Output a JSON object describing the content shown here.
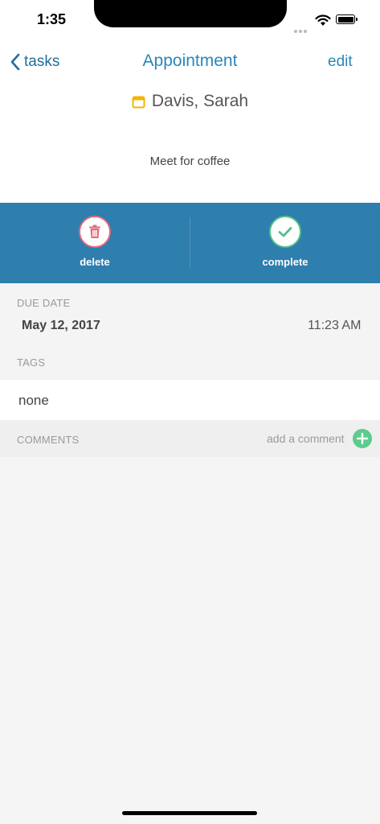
{
  "status_bar": {
    "time": "1:35"
  },
  "nav": {
    "back_label": "tasks",
    "title": "Appointment",
    "edit_label": "edit"
  },
  "task": {
    "contact_name": "Davis, Sarah",
    "note": "Meet for coffee"
  },
  "actions": {
    "delete_label": "delete",
    "complete_label": "complete"
  },
  "details": {
    "due_date_label": "DUE DATE",
    "due_date": "May 12, 2017",
    "due_time": "11:23 AM",
    "tags_label": "TAGS",
    "tags_value": "none",
    "comments_label": "COMMENTS",
    "add_comment_label": "add a comment"
  },
  "colors": {
    "accent": "#2b86b7",
    "action_bar": "#2e7eae",
    "delete": "#e06a7c",
    "complete": "#53c08a",
    "calendar_icon": "#f5b400"
  }
}
